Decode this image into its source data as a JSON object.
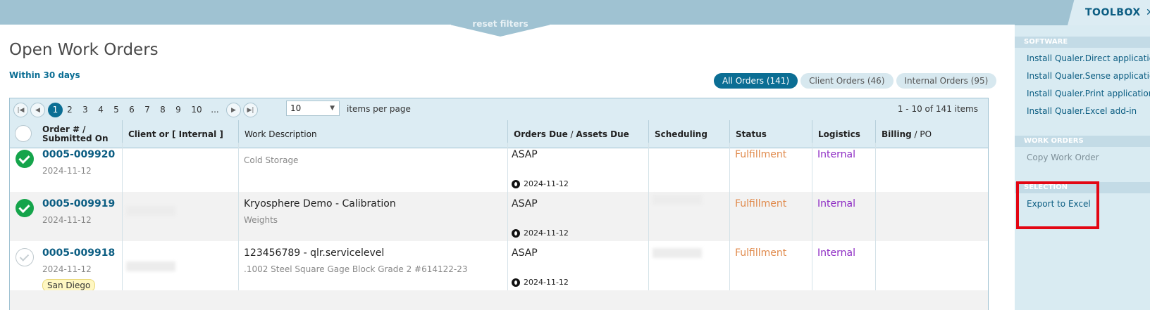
{
  "topbar": {
    "reset_filters": "reset filters"
  },
  "toolbox": {
    "title": "TOOLBOX",
    "close_glyph": "✕",
    "sections": {
      "software": "SOFTWARE",
      "work_orders": "WORK ORDERS",
      "selection": "SELECTION"
    },
    "software_items": [
      "Install Qualer.Direct application",
      "Install Qualer.Sense application",
      "Install Qualer.Print application",
      "Install Qualer.Excel add-in"
    ],
    "work_order_items": [
      "Copy Work Order"
    ],
    "selection_items": [
      "Export to Excel"
    ],
    "highlight_color": "#e30613"
  },
  "page": {
    "title": "Open Work Orders",
    "subtitle": "Within 30 days"
  },
  "filter_tabs": [
    {
      "label": "All Orders (141)",
      "active": true
    },
    {
      "label": "Client Orders (46)",
      "active": false
    },
    {
      "label": "Internal Orders (95)",
      "active": false
    }
  ],
  "pager": {
    "first_glyph": "|◀",
    "prev_glyph": "◀",
    "next_glyph": "▶",
    "last_glyph": "▶|",
    "pages": [
      "1",
      "2",
      "3",
      "4",
      "5",
      "6",
      "7",
      "8",
      "9",
      "10",
      "..."
    ],
    "current_page": "1",
    "page_size": "10",
    "page_size_label": "items per page",
    "summary": "1 - 10 of 141 items"
  },
  "columns": {
    "order_line1": "Order # /",
    "order_line2": "Submitted On",
    "client": "Client or [ Internal ]",
    "description": "Work Description",
    "due_a": "Orders Due",
    "due_sep": " / ",
    "due_b": "Assets Due",
    "scheduling": "Scheduling",
    "status": "Status",
    "logistics": "Logistics",
    "billing": "Billing",
    "billing_sep": " / ",
    "po": "PO"
  },
  "rows": [
    {
      "checked": true,
      "order_no": "0005-009920",
      "submitted": "2024-11-12",
      "location": "",
      "desc_title": "",
      "desc_sub": "Cold Storage",
      "orders_due": "ASAP",
      "assets_due": "2024-11-12",
      "status": "Fulfillment",
      "logistics": "Internal"
    },
    {
      "checked": true,
      "order_no": "0005-009919",
      "submitted": "2024-11-12",
      "location": "",
      "desc_title": "Kryosphere Demo - Calibration",
      "desc_sub": "Weights",
      "orders_due": "ASAP",
      "assets_due": "2024-11-12",
      "status": "Fulfillment",
      "logistics": "Internal"
    },
    {
      "checked": false,
      "order_no": "0005-009918",
      "submitted": "2024-11-12",
      "location": "San Diego",
      "desc_title": "123456789 - qlr.servicelevel",
      "desc_sub": ".1002 Steel Square Gage Block Grade 2 #614122-23",
      "orders_due": "ASAP",
      "assets_due": "2024-11-12",
      "status": "Fulfillment",
      "logistics": "Internal"
    }
  ],
  "colors": {
    "accent": "#0b6e94",
    "status_fulfillment": "#e08a4c",
    "logistics_internal": "#8e2cc4",
    "check_done": "#15a44b"
  }
}
